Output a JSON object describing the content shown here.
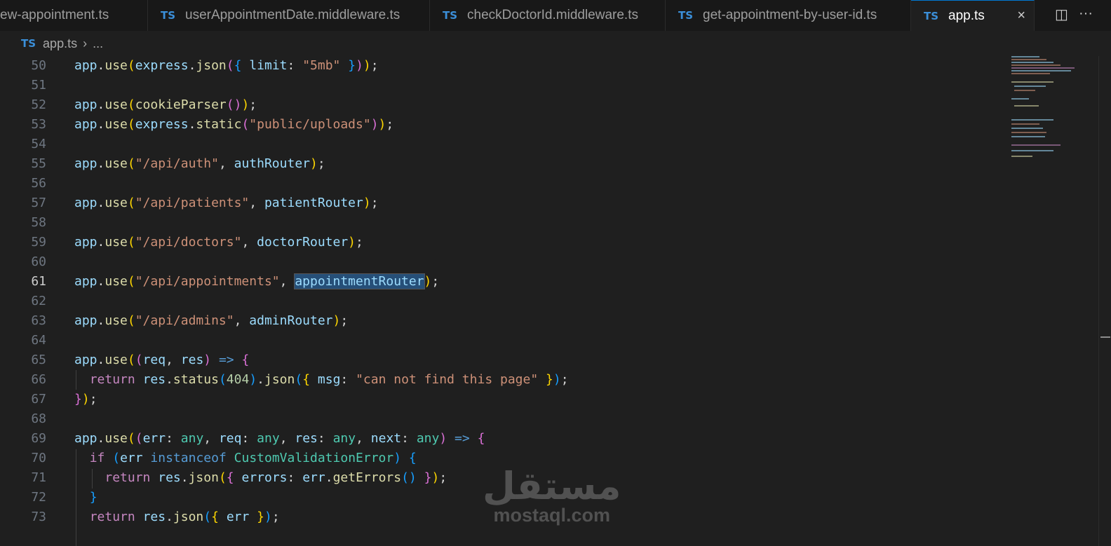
{
  "tabs": [
    {
      "badge": "TS",
      "name": "ew-appointment.ts"
    },
    {
      "badge": "TS",
      "name": "userAppointmentDate.middleware.ts"
    },
    {
      "badge": "TS",
      "name": "checkDoctorId.middleware.ts"
    },
    {
      "badge": "TS",
      "name": "get-appointment-by-user-id.ts"
    },
    {
      "badge": "TS",
      "name": "app.ts",
      "active": true
    }
  ],
  "tab_close_icon": "×",
  "actions": {
    "split_icon": "split-editor-icon",
    "more_icon": "more-actions-icon",
    "split_glyph": "◫",
    "more_glyph": "···"
  },
  "breadcrumb": {
    "badge": "TS",
    "file": "app.ts",
    "separator": "›",
    "more": "..."
  },
  "editor": {
    "lines": [
      {
        "n": "50"
      },
      {
        "n": "51"
      },
      {
        "n": "52"
      },
      {
        "n": "53"
      },
      {
        "n": "54"
      },
      {
        "n": "55"
      },
      {
        "n": "56"
      },
      {
        "n": "57"
      },
      {
        "n": "58"
      },
      {
        "n": "59"
      },
      {
        "n": "60"
      },
      {
        "n": "61"
      },
      {
        "n": "62"
      },
      {
        "n": "63"
      },
      {
        "n": "64"
      },
      {
        "n": "65"
      },
      {
        "n": "66"
      },
      {
        "n": "67"
      },
      {
        "n": "68"
      },
      {
        "n": "69"
      },
      {
        "n": "70"
      },
      {
        "n": "71"
      },
      {
        "n": "72"
      },
      {
        "n": "73"
      }
    ],
    "current_line": "61"
  },
  "code": {
    "app": "app",
    "use": "use",
    "express": "express",
    "json": "json",
    "limit": "limit",
    "limit_val": "\"5mb\"",
    "cookieParser": "cookieParser",
    "static": "static",
    "uploads": "\"public/uploads\"",
    "auth_path": "\"/api/auth\"",
    "authRouter": "authRouter",
    "patients_path": "\"/api/patients\"",
    "patientRouter": "patientRouter",
    "doctors_path": "\"/api/doctors\"",
    "doctorRouter": "doctorRouter",
    "appointments_path": "\"/api/appointments\"",
    "appointmentRouter": "appointmentRouter",
    "admins_path": "\"/api/admins\"",
    "adminRouter": "adminRouter",
    "req": "req",
    "res": "res",
    "return": "return",
    "status": "status",
    "code404": "404",
    "msg": "msg",
    "not_found": "\"can not find this page\"",
    "err": "err",
    "any": "any",
    "next": "next",
    "if": "if",
    "instanceof": "instanceof",
    "CustomValidationError": "CustomValidationError",
    "errors": "errors",
    "getErrors": "getErrors"
  },
  "watermark": {
    "arabic": "مستقل",
    "latin": "mostaql.com"
  },
  "colors": {
    "accent": "#0078d4",
    "background": "#1f1f1f",
    "ts_badge": "#3b8fd9"
  }
}
